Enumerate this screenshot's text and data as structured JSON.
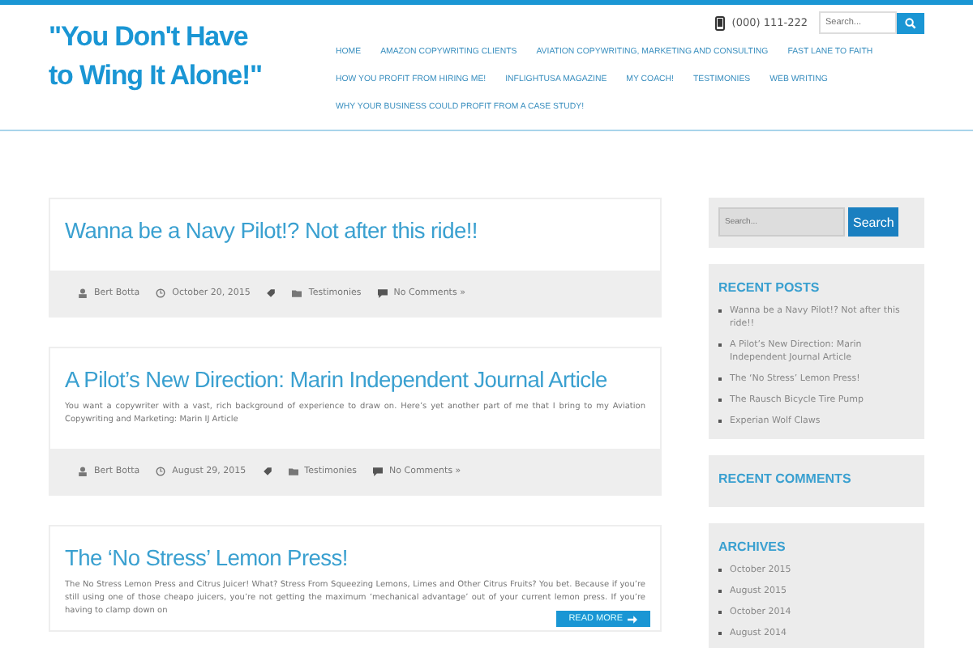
{
  "site_title": "\"You Don't Have to Wing It Alone!\"",
  "phone": "(000) 111-222",
  "header_search": {
    "placeholder": "Search..."
  },
  "nav": [
    "HOME",
    "AMAZON COPYWRITING CLIENTS",
    "AVIATION COPYWRITING, MARKETING AND CONSULTING",
    "FAST LANE TO FAITH",
    "HOW YOU PROFIT FROM HIRING ME!",
    "INFLIGHTUSA MAGAZINE",
    "MY COACH!",
    "TESTIMONIES",
    "WEB WRITING",
    "WHY YOUR BUSINESS COULD PROFIT FROM A CASE STUDY!"
  ],
  "posts": [
    {
      "title": "Wanna be a Navy Pilot!? Not after this ride!!",
      "author": "Bert Botta",
      "date": "October 20, 2015",
      "category": "Testimonies",
      "comments": "No Comments »"
    },
    {
      "title": "A Pilot’s New Direction: Marin Independent Journal Article",
      "excerpt": "You want a copywriter with a vast, rich background of experience to draw on. Here’s yet another part of me that I bring to my Aviation Copywriting and Marketing: Marin IJ Article",
      "author": "Bert Botta",
      "date": "August 29, 2015",
      "category": "Testimonies",
      "comments": "No Comments »"
    },
    {
      "title": "The ‘No Stress’ Lemon Press!",
      "excerpt": "The No Stress Lemon Press and Citrus Juicer!  What? Stress From Squeezing Lemons, Limes and Other Citrus Fruits? You bet. Because if you’re still using one of those cheapo juicers, you’re not getting the maximum ‘mechanical advantage’ out of your current lemon press.  If you’re having to clamp down on",
      "read_more": "READ MORE"
    }
  ],
  "sidebar": {
    "search": {
      "placeholder": "Search...",
      "button": "Search"
    },
    "widgets": [
      {
        "title": "RECENT POSTS",
        "items": [
          "Wanna be a Navy Pilot!? Not after this ride!!",
          "A Pilot’s New Direction: Marin Independent Journal Article",
          "The ‘No Stress’ Lemon Press!",
          "The Rausch Bicycle Tire Pump",
          "Experian Wolf Claws"
        ]
      },
      {
        "title": "RECENT COMMENTS"
      },
      {
        "title": "ARCHIVES",
        "items": [
          "October 2015",
          "August 2015",
          "October 2014",
          "August 2014"
        ]
      }
    ]
  }
}
